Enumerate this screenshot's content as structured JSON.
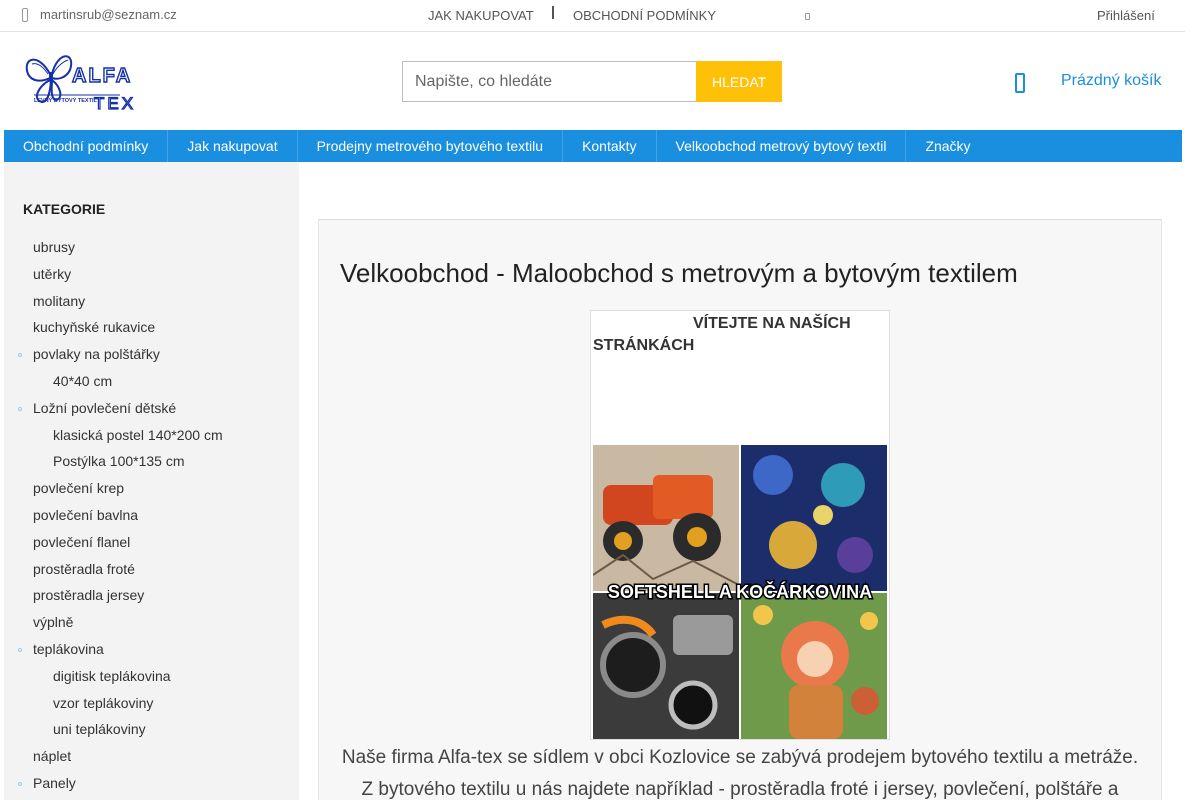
{
  "topbar": {
    "email": "martinsrub@seznam.cz",
    "nav": [
      "Jak nakupovat",
      "Obchodní podmínky"
    ],
    "login": "Přihlášení"
  },
  "logo": {
    "top_text": "ALFA",
    "bottom_text": "TEX",
    "tagline": "LEVNÝ BYTOVÝ TEXTIL"
  },
  "search": {
    "placeholder": "Napište, co hledáte",
    "button": "Hledat"
  },
  "cart": {
    "label": "Prázdný košík"
  },
  "mainnav": [
    "Obchodní podmínky",
    "Jak nakupovat",
    "Prodejny metrového bytového textilu",
    "Kontakty",
    "Velkoobchod metrový bytový textil",
    "Značky"
  ],
  "sidebar": {
    "heading": "Kategorie",
    "items": [
      {
        "label": "ubrusy",
        "level": 1,
        "bullet": false
      },
      {
        "label": "utěrky",
        "level": 1,
        "bullet": false
      },
      {
        "label": "molitany",
        "level": 1,
        "bullet": false
      },
      {
        "label": "kuchyňské rukavice",
        "level": 1,
        "bullet": false
      },
      {
        "label": "povlaky na polštářky",
        "level": 1,
        "bullet": true
      },
      {
        "label": "40*40 cm",
        "level": 2,
        "bullet": false
      },
      {
        "label": "Ložní povlečení dětské",
        "level": 1,
        "bullet": true
      },
      {
        "label": "klasická postel 140*200 cm",
        "level": 2,
        "bullet": false
      },
      {
        "label": "Postýlka 100*135 cm",
        "level": 2,
        "bullet": false
      },
      {
        "label": "povlečení krep",
        "level": 1,
        "bullet": false
      },
      {
        "label": "povlečení bavlna",
        "level": 1,
        "bullet": false
      },
      {
        "label": "povlečení flanel",
        "level": 1,
        "bullet": false
      },
      {
        "label": "prostěradla froté",
        "level": 1,
        "bullet": false
      },
      {
        "label": "prostěradla jersey",
        "level": 1,
        "bullet": false
      },
      {
        "label": "výplně",
        "level": 1,
        "bullet": false
      },
      {
        "label": "teplákovina",
        "level": 1,
        "bullet": true
      },
      {
        "label": "digitisk teplákovina",
        "level": 2,
        "bullet": false
      },
      {
        "label": "vzor teplákoviny",
        "level": 2,
        "bullet": false
      },
      {
        "label": "uni teplákoviny",
        "level": 2,
        "bullet": false
      },
      {
        "label": "náplet",
        "level": 1,
        "bullet": false
      },
      {
        "label": "Panely",
        "level": 1,
        "bullet": true
      }
    ]
  },
  "content": {
    "title": "Velkoobchod - Maloobchod s metrovým a bytovým textilem",
    "welcome": "Vítejte na naších stránkách",
    "promo_caption": "SOFTSHELL A KOČÁRKOVINA",
    "intro_line1": "Naše firma Alfa-tex se sídlem v obci Kozlovice se zabývá prodejem bytového textilu a metráže.",
    "intro_line2": "Z bytového textilu u nás najdete například - prostěradla froté i jersey, povlečení, polštáře a"
  },
  "colors": {
    "accent": "#1a8fe0",
    "search_button": "#ffc107",
    "sidebar_bg": "#f3f3f3"
  }
}
